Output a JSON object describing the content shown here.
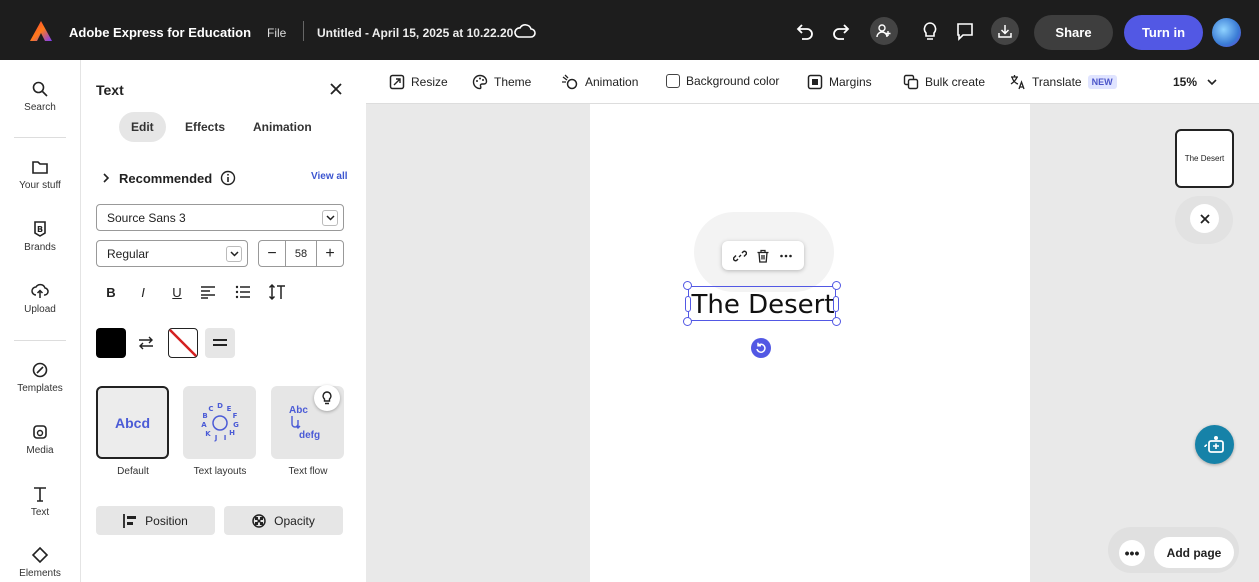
{
  "topbar": {
    "app_title": "Adobe Express for Education",
    "file_label": "File",
    "doc_title": "Untitled - April 15, 2025 at 10.22.20",
    "share_label": "Share",
    "turnin_label": "Turn in"
  },
  "rail": {
    "items": [
      {
        "label": "Search"
      },
      {
        "label": "Your stuff"
      },
      {
        "label": "Brands"
      },
      {
        "label": "Upload"
      },
      {
        "label": "Templates"
      },
      {
        "label": "Media"
      },
      {
        "label": "Text"
      },
      {
        "label": "Elements"
      }
    ]
  },
  "panel": {
    "title": "Text",
    "tabs": [
      {
        "label": "Edit",
        "active": true
      },
      {
        "label": "Effects",
        "active": false
      },
      {
        "label": "Animation",
        "active": false
      }
    ],
    "recommended_label": "Recommended",
    "view_all_label": "View all",
    "font_family": "Source Sans 3",
    "font_weight": "Regular",
    "font_size": "58",
    "format_buttons": [
      "B",
      "I",
      "U"
    ],
    "text_color": "#000000",
    "cards": [
      {
        "label": "Default",
        "preview": "Abcd"
      },
      {
        "label": "Text layouts",
        "preview": "ABCDEFGHIJK"
      },
      {
        "label": "Text flow",
        "preview_top": "Abc",
        "preview_bottom": "defg"
      }
    ],
    "position_label": "Position",
    "opacity_label": "Opacity"
  },
  "toolbar": {
    "resize": "Resize",
    "theme": "Theme",
    "animation": "Animation",
    "background_color": "Background color",
    "margins": "Margins",
    "bulk_create": "Bulk create",
    "translate": "Translate",
    "new_badge": "NEW",
    "zoom": "15%"
  },
  "canvas": {
    "selected_text": "The Desert",
    "thumbnail_text": "The Desert",
    "add_page_label": "Add page",
    "more_label": "•••"
  },
  "colors": {
    "accent": "#5258e4",
    "topbar_bg": "#1d1d1d",
    "assistant": "#1682a8"
  }
}
